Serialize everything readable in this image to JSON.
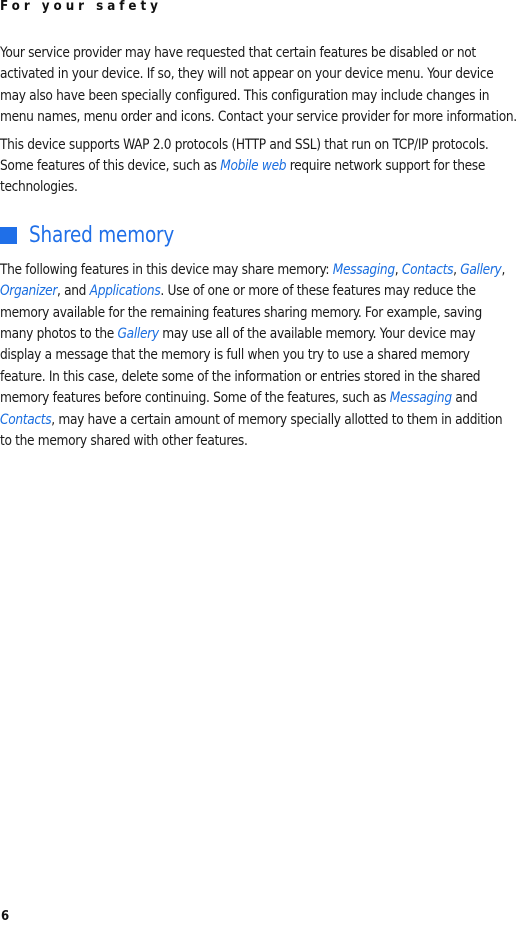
{
  "header": {
    "title": "For your safety"
  },
  "paragraphs": {
    "p1": "Your service provider may have requested that certain features be disabled or not activated in your device. If so, they will not appear on your device menu. Your device may also have been specially configured. This configuration may include changes in menu names, menu order and icons. Contact your service provider for more information.",
    "p2_a": "This device supports WAP 2.0 protocols (HTTP and SSL) that run on TCP/IP protocols. Some features of this device, such as ",
    "p2_link": "Mobile web",
    "p2_b": " require network support for these technologies."
  },
  "section": {
    "title": "Shared memory",
    "accent_color": "#1f6fe8",
    "body": {
      "t1": "The following features in this device may share memory: ",
      "l1": "Messaging",
      "t2": ", ",
      "l2": "Contacts",
      "t3": ", ",
      "l3": "Gallery",
      "t4": ", ",
      "l4": "Organizer",
      "t5": ", and ",
      "l5": "Applications",
      "t6": ". Use of one or more of these features may reduce the memory available for the remaining features sharing memory. For example, saving many photos to the ",
      "l6": "Gallery",
      "t7": " may use all of the available memory. Your device may display a message that the memory is full when you try to use a shared memory feature. In this case, delete some of the information or entries stored in the shared memory features before continuing. Some of the features, such as ",
      "l7": "Messaging",
      "t8": " and ",
      "l8": "Contacts",
      "t9": ", may have a certain amount of memory specially allotted to them in addition to the memory shared with other features."
    }
  },
  "footer": {
    "page_number": "6"
  }
}
